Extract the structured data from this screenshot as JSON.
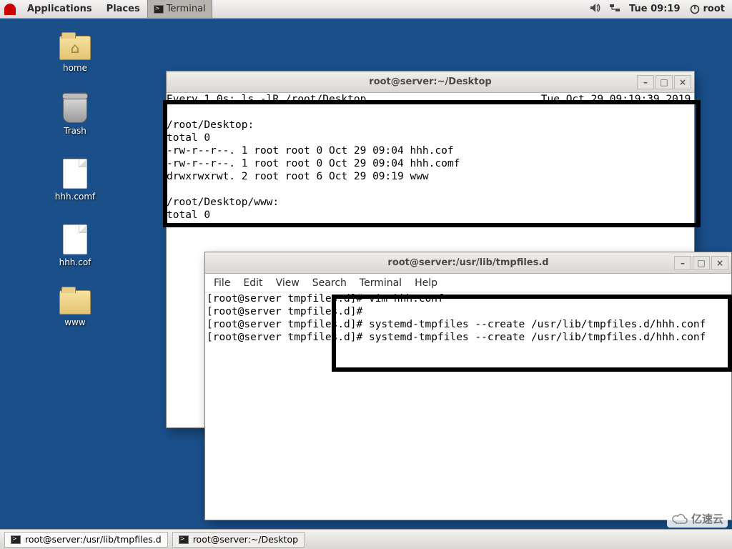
{
  "top_panel": {
    "applications": "Applications",
    "places": "Places",
    "terminal": "Terminal",
    "clock": "Tue 09:19",
    "user": "root"
  },
  "desktop_icons": {
    "home": "home",
    "trash": "Trash",
    "file1": "hhh.comf",
    "file2": "hhh.cof",
    "folder_www": "www"
  },
  "window1": {
    "title": "root@server:~/Desktop",
    "body": "Every 1.0s: ls -lR /root/Desktop                            Tue Oct 29 09:19:39 2019\n\n/root/Desktop:\ntotal 0\n-rw-r--r--. 1 root root 0 Oct 29 09:04 hhh.cof\n-rw-r--r--. 1 root root 0 Oct 29 09:04 hhh.comf\ndrwxrwxrwt. 2 root root 6 Oct 29 09:19 www\n\n/root/Desktop/www:\ntotal 0"
  },
  "window2": {
    "title": "root@server:/usr/lib/tmpfiles.d",
    "menu": {
      "file": "File",
      "edit": "Edit",
      "view": "View",
      "search": "Search",
      "terminal": "Terminal",
      "help": "Help"
    },
    "body": "[root@server tmpfiles.d]# vim hhh.conf\n[root@server tmpfiles.d]# \n[root@server tmpfiles.d]# systemd-tmpfiles --create /usr/lib/tmpfiles.d/hhh.conf\n[root@server tmpfiles.d]# systemd-tmpfiles --create /usr/lib/tmpfiles.d/hhh.conf"
  },
  "taskbar": {
    "task1": "root@server:/usr/lib/tmpfiles.d",
    "task2": "root@server:~/Desktop"
  },
  "watermark": "亿速云"
}
